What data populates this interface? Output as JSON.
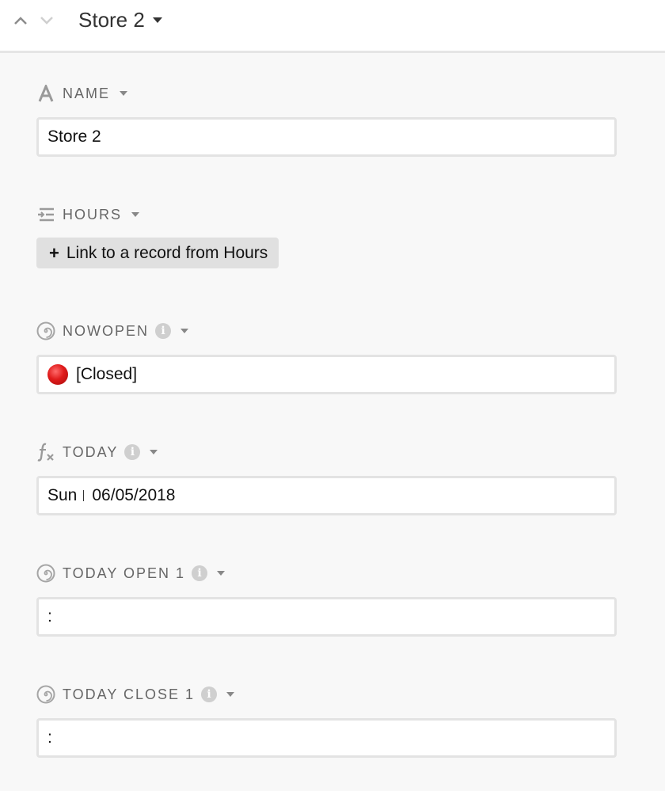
{
  "header": {
    "title": "Store 2",
    "prev_icon": "chevron-up-icon",
    "next_icon": "chevron-down-icon"
  },
  "fields": {
    "name": {
      "label": "NAME",
      "icon": "text-field-icon",
      "value": "Store 2"
    },
    "hours": {
      "label": "HOURS",
      "icon": "linked-record-icon",
      "button_label": "Link to a record from Hours",
      "button_icon": "plus-icon"
    },
    "nowopen": {
      "label": "NOWOPEN",
      "icon": "lookup-spiral-icon",
      "status_icon": "red-circle-icon",
      "value": "[Closed]"
    },
    "today": {
      "label": "TODAY",
      "icon": "formula-icon",
      "day": "Sun",
      "date": "06/05/2018"
    },
    "today_open_1": {
      "label": "TODAY OPEN 1",
      "icon": "lookup-spiral-icon",
      "value": ":"
    },
    "today_close_1": {
      "label": "TODAY CLOSE 1",
      "icon": "lookup-spiral-icon",
      "value": ":"
    }
  },
  "info_glyph": "i"
}
